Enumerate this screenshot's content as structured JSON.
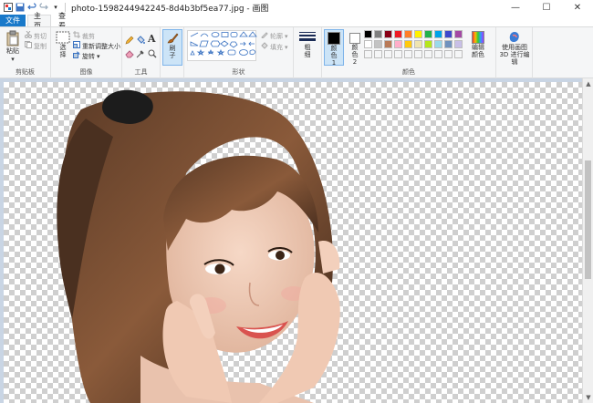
{
  "window": {
    "title": "photo-1598244942245-8d4b3bf5ea77.jpg - 画图",
    "minimize": "—",
    "maximize": "☐",
    "close": "✕"
  },
  "tabs": {
    "file": "文件",
    "home": "主页",
    "view": "查看"
  },
  "clipboard": {
    "paste": "粘贴",
    "cut": "剪切",
    "copy": "复制",
    "label": "剪贴板"
  },
  "image": {
    "select": "选择",
    "crop": "裁剪",
    "resize": "重新调整大小",
    "rotate": "旋转",
    "label": "图像"
  },
  "tools": {
    "label": "工具"
  },
  "brushes": {
    "label": "刷子"
  },
  "shapes": {
    "outline": "轮廓",
    "fill": "填充",
    "label": "形状"
  },
  "size": {
    "label": "粗细"
  },
  "colors": {
    "color1_label": "颜色 1",
    "color2_label": "颜色 2",
    "edit_label": "编辑颜色",
    "label": "颜色",
    "color1": "#000000",
    "color2": "#ffffff",
    "palette_row1": [
      "#000000",
      "#7f7f7f",
      "#880015",
      "#ed1c24",
      "#ff7f27",
      "#fff200",
      "#22b14c",
      "#00a2e8",
      "#3f48cc",
      "#a349a4"
    ],
    "palette_row2": [
      "#ffffff",
      "#c3c3c3",
      "#b97a57",
      "#ffaec9",
      "#ffc90e",
      "#efe4b0",
      "#b5e61d",
      "#99d9ea",
      "#7092be",
      "#c8bfe7"
    ]
  },
  "paint3d": {
    "label": "使用画图 3D 进行编辑"
  },
  "accent": "#1979ca"
}
